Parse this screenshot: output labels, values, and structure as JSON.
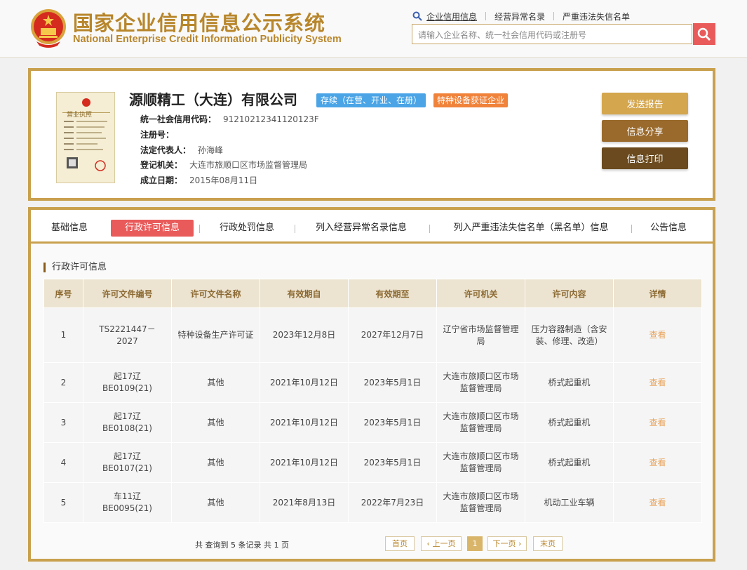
{
  "brand": {
    "title_cn": "国家企业信用信息公示系统",
    "title_en": "National Enterprise Credit Information Publicity System"
  },
  "topnav": {
    "items": [
      "企业信用信息",
      "经营异常名录",
      "严重违法失信名单"
    ]
  },
  "search": {
    "placeholder": "请输入企业名称、统一社会信用代码或注册号"
  },
  "company": {
    "name": "源顺精工（大连）有限公司",
    "status_badge": "存续（在营、开业、在册）",
    "tag_badge": "特种设备获证企业",
    "fields": [
      {
        "label": "统一社会信用代码：",
        "value": "91210212341120123F"
      },
      {
        "label": "注册号：",
        "value": ""
      },
      {
        "label": "法定代表人：",
        "value": "孙海峰"
      },
      {
        "label": "登记机关：",
        "value": "大连市旅顺口区市场监督管理局"
      },
      {
        "label": "成立日期：",
        "value": "2015年08月11日"
      }
    ],
    "license_label": "营业执照"
  },
  "actions": [
    "发送报告",
    "信息分享",
    "信息打印"
  ],
  "tabs": [
    "基础信息",
    "行政许可信息",
    "行政处罚信息",
    "列入经营异常名录信息",
    "列入严重违法失信名单（黑名单）信息",
    "公告信息"
  ],
  "section_title": "行政许可信息",
  "table": {
    "headers": [
      "序号",
      "许可文件编号",
      "许可文件名称",
      "有效期自",
      "有效期至",
      "许可机关",
      "许可内容",
      "详情"
    ],
    "rows": [
      [
        "1",
        "TS2221447－2027",
        "特种设备生产许可证",
        "2023年12月8日",
        "2027年12月7日",
        "辽宁省市场监督管理局",
        "压力容器制造（含安装、修理、改造）",
        "查看"
      ],
      [
        "2",
        "起17辽BE0109(21)",
        "其他",
        "2021年10月12日",
        "2023年5月1日",
        "大连市旅顺口区市场监督管理局",
        "桥式起重机",
        "查看"
      ],
      [
        "3",
        "起17辽BE0108(21)",
        "其他",
        "2021年10月12日",
        "2023年5月1日",
        "大连市旅顺口区市场监督管理局",
        "桥式起重机",
        "查看"
      ],
      [
        "4",
        "起17辽BE0107(21)",
        "其他",
        "2021年10月12日",
        "2023年5月1日",
        "大连市旅顺口区市场监督管理局",
        "桥式起重机",
        "查看"
      ],
      [
        "5",
        "车11辽BE0095(21)",
        "其他",
        "2021年8月13日",
        "2022年7月23日",
        "大连市旅顺口区市场监督管理局",
        "机动工业车辆",
        "查看"
      ]
    ]
  },
  "pager": {
    "summary": "共 查询到 5 条记录 共 1 页",
    "first": "首页",
    "prev": "‹ 上一页",
    "current": "1",
    "next": "下一页 ›",
    "last": "末页"
  },
  "colors": {
    "gold": "#c8a04e",
    "red_accent": "#e95b5b",
    "blue_badge": "#4aa4e6",
    "orange_badge": "#f0823a"
  }
}
